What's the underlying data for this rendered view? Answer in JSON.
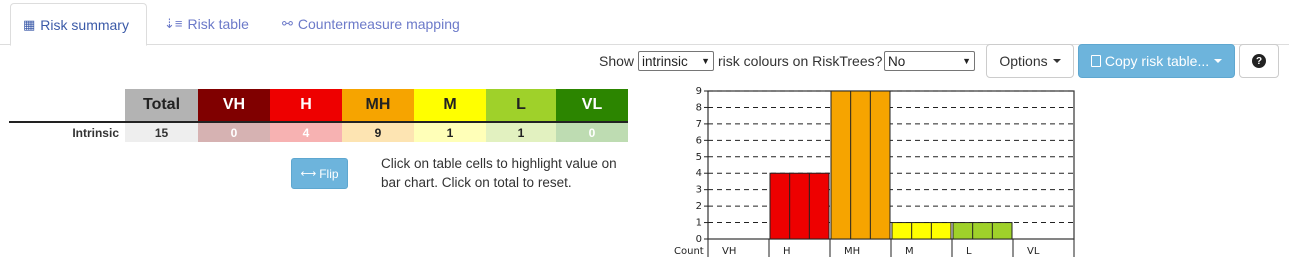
{
  "tabs": [
    {
      "label": "Risk summary",
      "icon": "table-icon"
    },
    {
      "label": "Risk table",
      "icon": "sort-icon"
    },
    {
      "label": "Countermeasure mapping",
      "icon": "network-icon"
    }
  ],
  "controls": {
    "show_label": "Show",
    "intrinsic_value": "intrinsic",
    "middle_label": "risk colours on RiskTrees?",
    "no_value": "No",
    "options_label": "Options",
    "copy_label": "Copy risk table...",
    "help_label": "?"
  },
  "summary_table": {
    "row_label": "Intrinsic",
    "columns": [
      {
        "key": "Total",
        "value": "15",
        "header_bg": "#b3b3b3",
        "header_fg": "#222222",
        "cell_bg": "#eeeeee"
      },
      {
        "key": "VH",
        "value": "0",
        "header_bg": "#800000",
        "header_fg": "#ffffff",
        "cell_bg": "#d6b2b2"
      },
      {
        "key": "H",
        "value": "4",
        "header_bg": "#ee0000",
        "header_fg": "#ffffff",
        "cell_bg": "#f7b2b2"
      },
      {
        "key": "MH",
        "value": "9",
        "header_bg": "#f6a400",
        "header_fg": "#222222",
        "cell_bg": "#fde4b2"
      },
      {
        "key": "M",
        "value": "1",
        "header_bg": "#ffff00",
        "header_fg": "#222222",
        "cell_bg": "#ffffb8"
      },
      {
        "key": "L",
        "value": "1",
        "header_bg": "#9fd12a",
        "header_fg": "#222222",
        "cell_bg": "#e2f1c0"
      },
      {
        "key": "VL",
        "value": "0",
        "header_bg": "#2c8500",
        "header_fg": "#ffffff",
        "cell_bg": "#bedcb2"
      }
    ]
  },
  "flip_label": "Flip",
  "hint_text": "Click on table cells to highlight value on bar chart. Click on total to reset.",
  "chart_data": {
    "type": "bar",
    "categories": [
      "VH",
      "H",
      "MH",
      "M",
      "L",
      "VL"
    ],
    "values": [
      0,
      4,
      9,
      1,
      1,
      0
    ],
    "colors": [
      "#800000",
      "#ee0000",
      "#f6a400",
      "#ffff00",
      "#9fd12a",
      "#2c8500"
    ],
    "ylim": [
      0,
      9
    ],
    "yticks": [
      0,
      1,
      2,
      3,
      4,
      5,
      6,
      7,
      8,
      9
    ],
    "xlabel": "Count",
    "grid": "dashed horizontal"
  }
}
